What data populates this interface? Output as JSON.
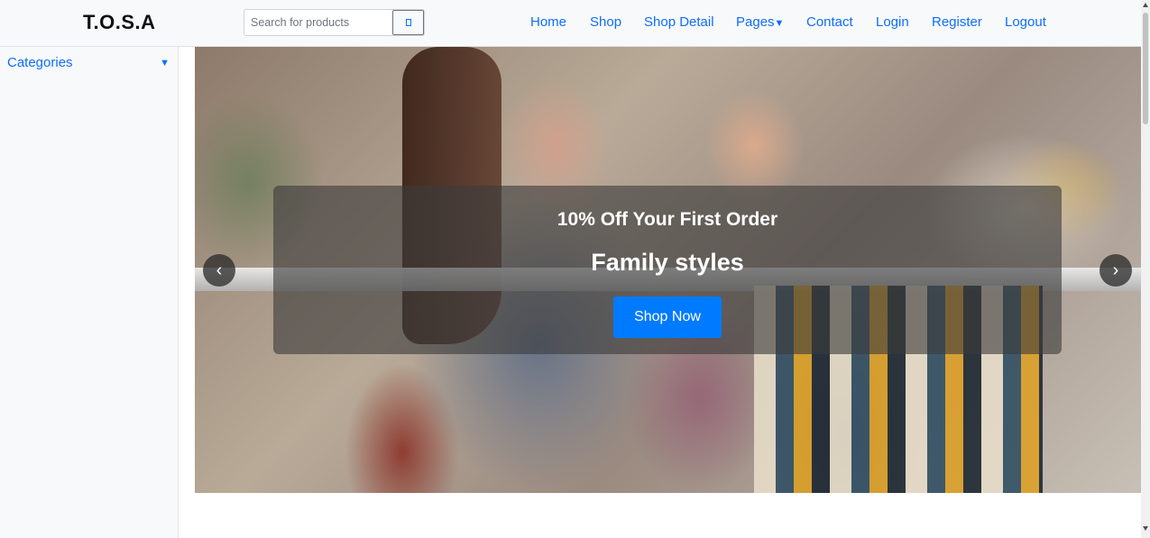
{
  "header": {
    "brand": "T.O.S.A",
    "search": {
      "placeholder": "Search for products",
      "value": "",
      "button_icon": "search-icon"
    },
    "nav": [
      {
        "label": "Home"
      },
      {
        "label": "Shop"
      },
      {
        "label": "Shop Detail"
      },
      {
        "label": "Pages",
        "caret": "▼"
      },
      {
        "label": "Contact"
      },
      {
        "label": "Login"
      },
      {
        "label": "Register"
      },
      {
        "label": "Logout"
      }
    ]
  },
  "sidebar": {
    "categories_label": "Categories",
    "categories_caret": "▼"
  },
  "carousel": {
    "slide": {
      "promo": "10% Off Your First Order",
      "title": "Family styles",
      "button_label": "Shop Now"
    },
    "prev_glyph": "‹",
    "next_glyph": "›"
  },
  "colors": {
    "link": "#0d6efd",
    "button": "#007bff",
    "header_bg": "#f8f9fa"
  }
}
